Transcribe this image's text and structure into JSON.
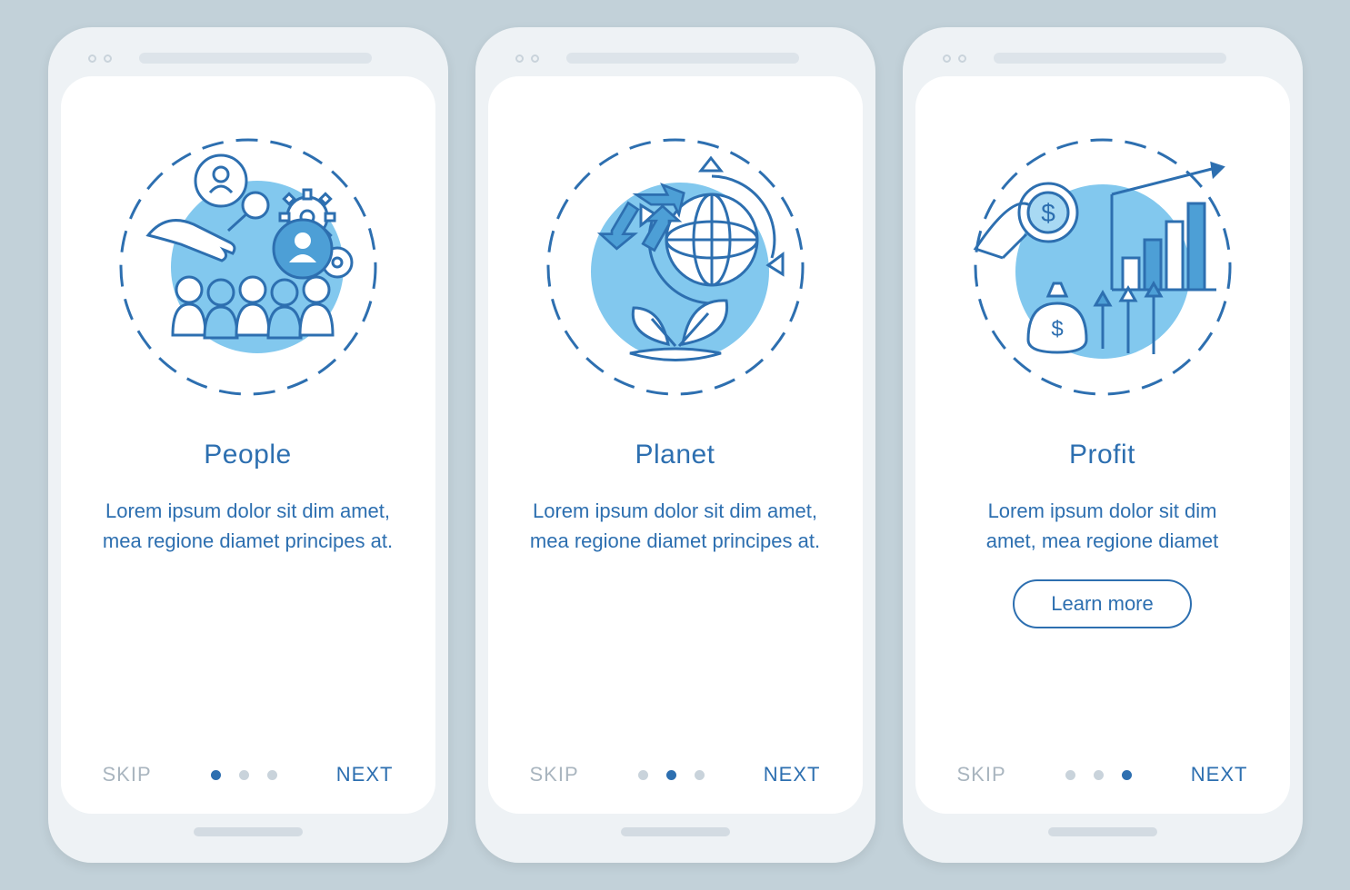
{
  "colors": {
    "primary": "#2d6fb0",
    "muted": "#a9b5bf",
    "accent_fill": "#6bbbe8"
  },
  "nav": {
    "skip": "SKIP",
    "next": "NEXT"
  },
  "screens": [
    {
      "icon": "people-icon",
      "title": "People",
      "body": "Lorem ipsum dolor sit dim amet, mea regione diamet principes at.",
      "cta": null,
      "active_dot": 0
    },
    {
      "icon": "planet-icon",
      "title": "Planet",
      "body": "Lorem ipsum dolor sit dim amet, mea regione diamet principes at.",
      "cta": null,
      "active_dot": 1
    },
    {
      "icon": "profit-icon",
      "title": "Profit",
      "body": "Lorem ipsum dolor sit dim amet, mea regione diamet",
      "cta": "Learn more",
      "active_dot": 2
    }
  ]
}
